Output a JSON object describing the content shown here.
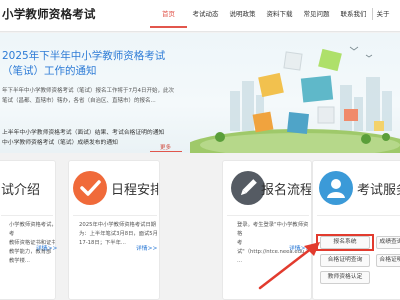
{
  "header": {
    "site_title": "小学教师资格考试",
    "nav": [
      "首页",
      "考试动态",
      "说明政策",
      "资料下载",
      "常见问题",
      "联系我们",
      "关于"
    ],
    "active_index": 0
  },
  "banner": {
    "news_title": "2025年下半年中小学教师资格考试（笔试）工作的通知",
    "news_summary": "年下半年中小学教师资格考试（笔试）报名工作将于7月4日开始，此次笔试（昌都、直辖市）辖办，各省（自治区、直辖市）的报名...",
    "news_links": [
      "上半年中小学教师资格考试（面试）结果、考试合格证明的通知",
      "中小学教师资格考试（笔试）成绩发布的通知"
    ],
    "more_label": "更多",
    "colors": {
      "accent": "#e2564c",
      "link": "#2d7bd6"
    }
  },
  "cards": {
    "intro": {
      "title": "试介绍",
      "text": "小学教师资格考试，考\n教师资格证书和证书\n教学能力，教育部\n教学楼...",
      "detail": "详情>>"
    },
    "schedule": {
      "title": "日程安排",
      "icon": "checkmark-icon",
      "text": "2025年中小学教师资格考试日期\n为：上半年笔试3月8日，面试5月\n17-18日；下半年...",
      "detail": "详情>>"
    },
    "registration": {
      "title": "报名流程",
      "icon": "pencil-icon",
      "text": "登录。考生登录\"中小学教师资格\n考试\"（http://ntce.neea.edu.\n...",
      "detail": "详情>>"
    },
    "services": {
      "title": "考试服务",
      "icon": "person-icon",
      "buttons": [
        "报名系统",
        "成绩查询",
        "合格证明查询",
        "合格证明",
        "教师资格认定"
      ]
    }
  }
}
